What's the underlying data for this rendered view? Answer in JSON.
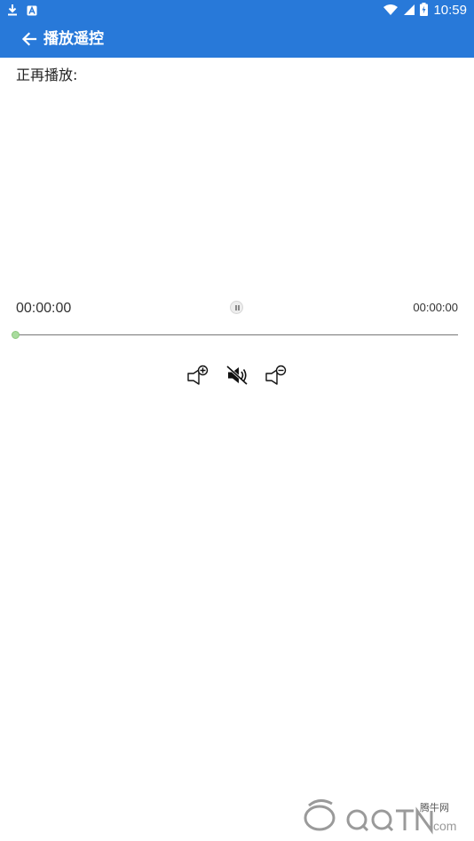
{
  "status_bar": {
    "time": "10:59",
    "icons": [
      "download-icon",
      "app-notification-icon",
      "wifi-icon",
      "signal-icon",
      "battery-icon"
    ],
    "background": "#2879d9"
  },
  "app_bar": {
    "title": "播放遥控",
    "back_icon": "arrow-left-icon",
    "background": "#2879d9"
  },
  "player": {
    "now_playing_label": "正再播放:",
    "current_time": "00:00:00",
    "total_time": "00:00:00",
    "progress": 0,
    "pause_icon": "pause-icon",
    "controls": [
      {
        "name": "volume-up-button",
        "icon": "volume-up-icon"
      },
      {
        "name": "mute-button",
        "icon": "mute-icon"
      },
      {
        "name": "volume-down-button",
        "icon": "volume-down-icon"
      }
    ]
  },
  "watermark": {
    "text": "腾牛网",
    "logo_icon": "qqtn-logo-icon"
  }
}
